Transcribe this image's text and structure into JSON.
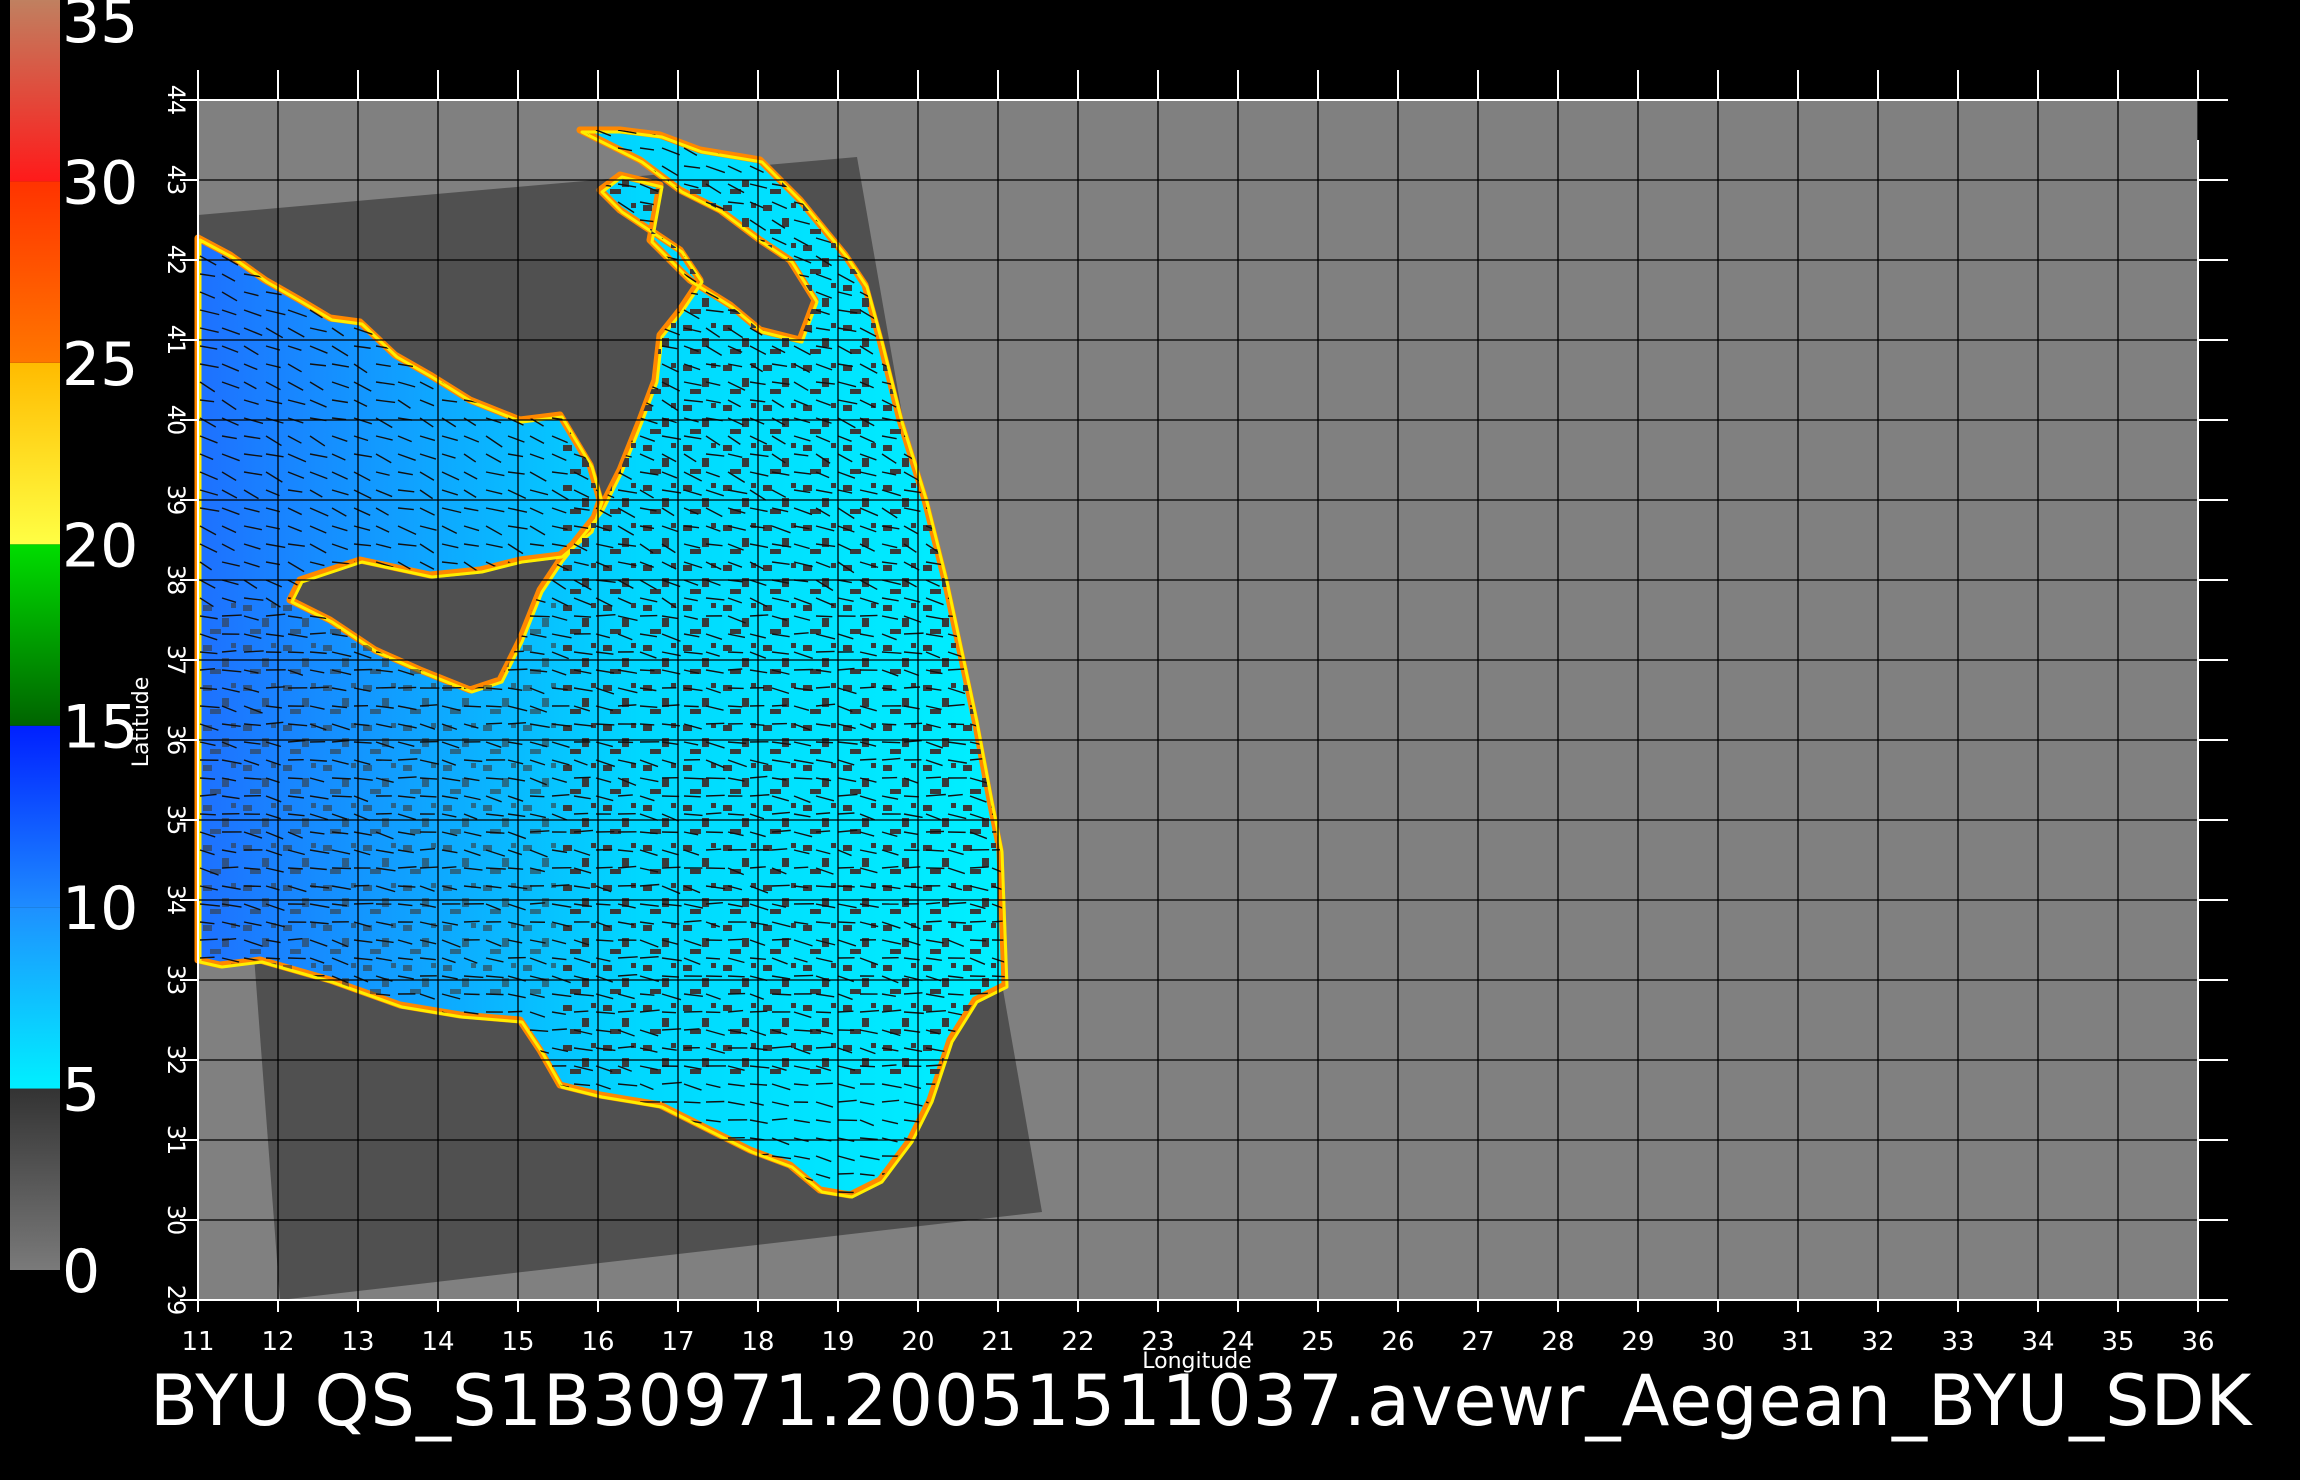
{
  "window": {
    "title": "BYU  QS_S1B30971.20051511037.avewr_Aegean_BYU_SDK"
  },
  "map": {
    "axes": {
      "xlabel": "Longitude",
      "ylabel": "Latitude",
      "x_range": [
        11,
        36
      ],
      "y_range": [
        29,
        44
      ],
      "x_ticks": [
        "11",
        "12",
        "13",
        "14",
        "15",
        "16",
        "17",
        "18",
        "19",
        "20",
        "21",
        "22",
        "23",
        "24",
        "25",
        "26",
        "27",
        "28",
        "29",
        "30",
        "31",
        "32",
        "33",
        "34",
        "35",
        "36"
      ],
      "y_ticks": [
        "29",
        "30",
        "31",
        "32",
        "33",
        "34",
        "35",
        "36",
        "37",
        "38",
        "39",
        "40",
        "41",
        "42",
        "43",
        "44"
      ],
      "grid": true
    },
    "colorbar": {
      "ticks": [
        "0",
        "5",
        "10",
        "15",
        "20",
        "25",
        "30",
        "35"
      ],
      "range": [
        0,
        35
      ],
      "stops": [
        {
          "from": 0,
          "to": 5,
          "colors": [
            "#7a7a7a",
            "#333333"
          ]
        },
        {
          "from": 5,
          "to": 10,
          "colors": [
            "#00f0ff",
            "#1e90ff"
          ]
        },
        {
          "from": 10,
          "to": 15,
          "colors": [
            "#1e8cff",
            "#0020ff"
          ]
        },
        {
          "from": 15,
          "to": 20,
          "colors": [
            "#006400",
            "#00dd00"
          ]
        },
        {
          "from": 20,
          "to": 25,
          "colors": [
            "#ffff44",
            "#ffbb00"
          ]
        },
        {
          "from": 25,
          "to": 30,
          "colors": [
            "#ff7700",
            "#ff3300"
          ]
        },
        {
          "from": 30,
          "to": 35,
          "colors": [
            "#ff1a1a",
            "#c08060"
          ]
        }
      ]
    },
    "colors": {
      "background": "#000000",
      "plot_area": "#808080",
      "swath": "#505050",
      "sea_fast": "#00e8ff",
      "sea_slow": "#1e70ff",
      "grid": "#000000"
    }
  }
}
